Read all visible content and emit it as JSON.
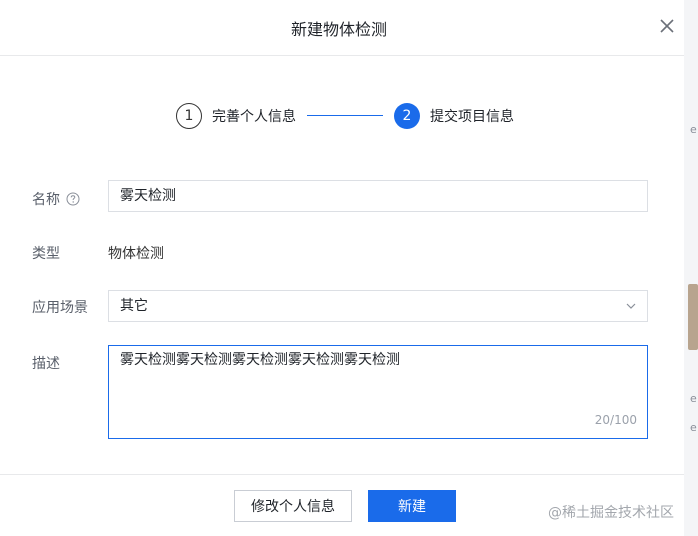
{
  "dialog": {
    "title": "新建物体检测",
    "close_icon": "close-icon"
  },
  "steps": [
    {
      "number": "1",
      "label": "完善个人信息",
      "state": "completed"
    },
    {
      "number": "2",
      "label": "提交项目信息",
      "state": "active"
    }
  ],
  "form": {
    "name": {
      "label": "名称",
      "value": "雾天检测",
      "help_icon": "question-circle-icon"
    },
    "type": {
      "label": "类型",
      "value": "物体检测"
    },
    "scene": {
      "label": "应用场景",
      "value": "其它",
      "icon": "chevron-down-icon"
    },
    "description": {
      "label": "描述",
      "value": "雾天检测雾天检测雾天检测雾天检测雾天检测",
      "counter": "20/100"
    }
  },
  "footer": {
    "back_label": "修改个人信息",
    "submit_label": "新建"
  },
  "watermark": "@稀土掘金技术社区",
  "background_fragments": [
    "e",
    "e",
    "e"
  ],
  "colors": {
    "primary": "#1a6bea",
    "border": "#dcdfe4",
    "text": "#1f2329",
    "label": "#595f6a"
  }
}
